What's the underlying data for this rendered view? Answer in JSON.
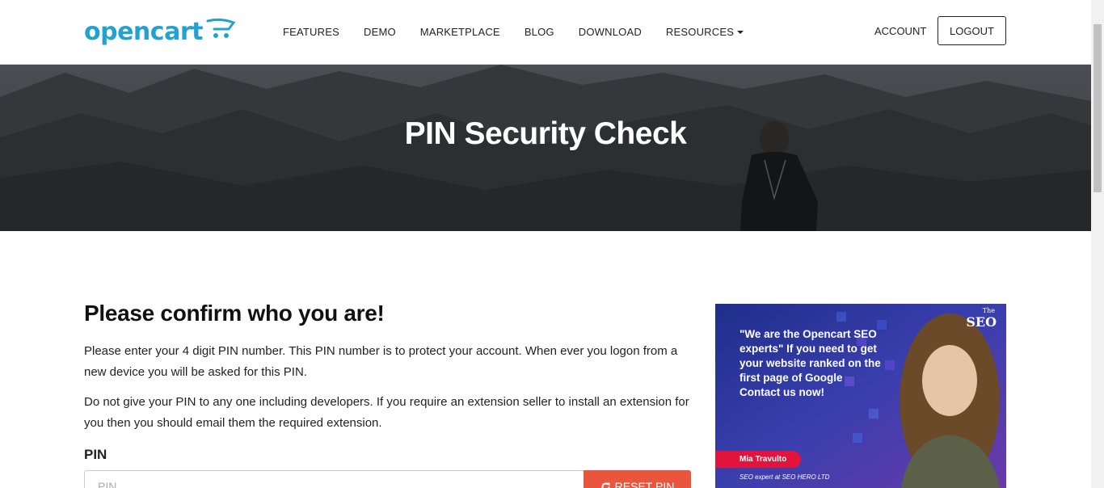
{
  "header": {
    "logo_text": "opencart",
    "nav": [
      "FEATURES",
      "DEMO",
      "MARKETPLACE",
      "BLOG",
      "DOWNLOAD",
      "RESOURCES"
    ],
    "account_label": "ACCOUNT",
    "logout_label": "LOGOUT",
    "brand_color": "#23a1d1"
  },
  "hero": {
    "title": "PIN Security Check"
  },
  "main": {
    "heading": "Please confirm who you are!",
    "paragraph_1": "Please enter your 4 digit PIN number. This PIN number is to protect your account. When ever you logon from a new device you will be asked for this PIN.",
    "paragraph_2": "Do not give your PIN to any one including developers. If you require an extension seller to install an extension for you then you should email them the required extension.",
    "pin_label": "PIN",
    "pin_placeholder": "PIN",
    "reset_label": "RESET PIN",
    "reset_icon": "refresh-icon",
    "accent_color": "#e9553d"
  },
  "ad": {
    "brand_small": "The",
    "brand_big": "SEO",
    "quote": "\"We are the Opencart SEO experts\" If you need to get your website ranked on the first page of Google Contact us now!",
    "person_name": "Mia Travulto",
    "caption": "SEO expert at SEO HERO LTD"
  }
}
